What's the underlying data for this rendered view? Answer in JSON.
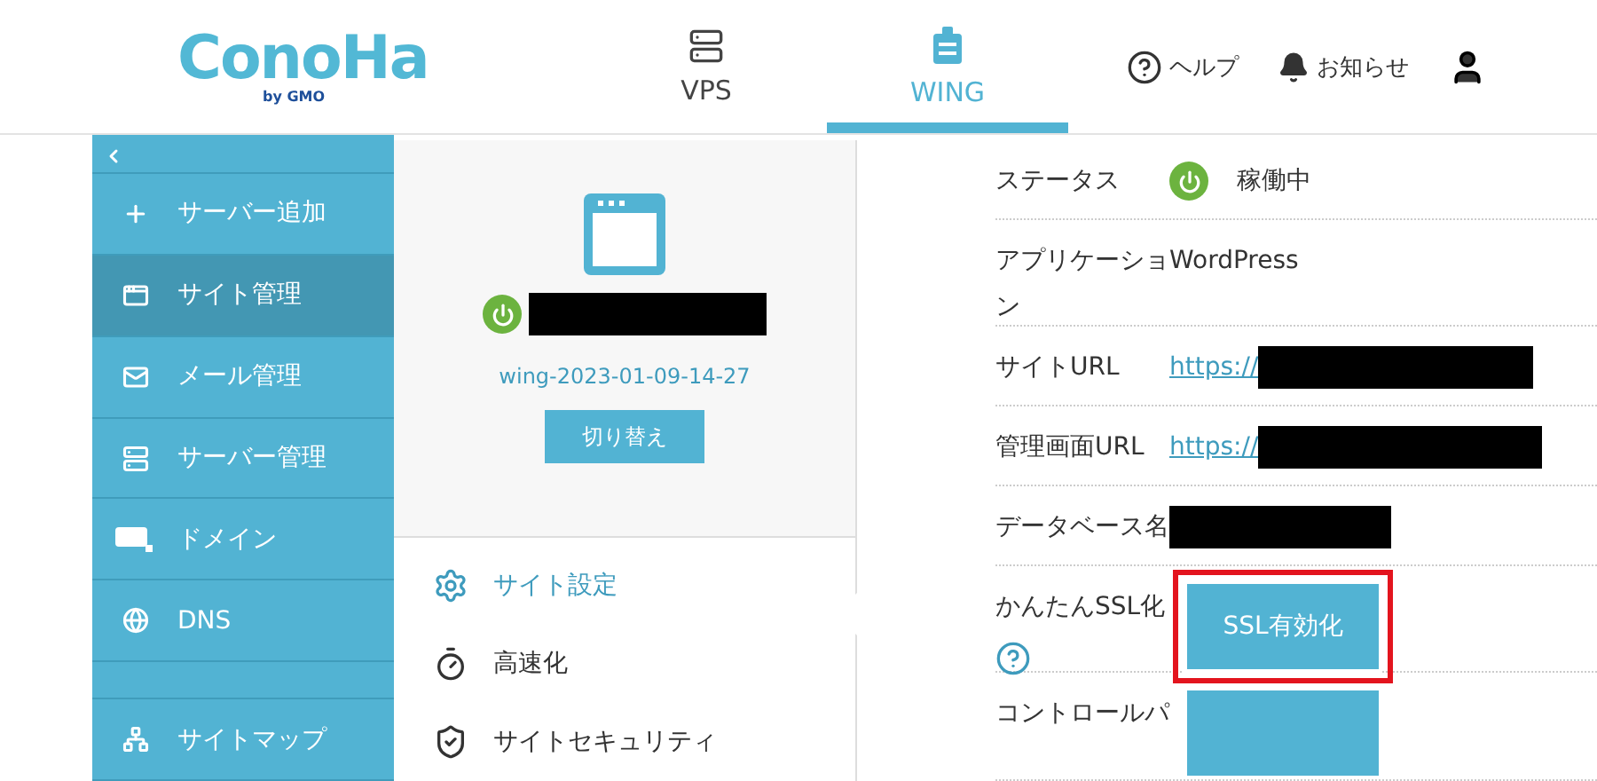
{
  "header": {
    "logo": {
      "name": "ConoHa",
      "sub": "by GMO"
    },
    "nav": [
      {
        "label": "VPS",
        "selected": false
      },
      {
        "label": "WING",
        "selected": true
      }
    ],
    "actions": [
      {
        "kind": "help",
        "label": "ヘルプ"
      },
      {
        "kind": "bell",
        "label": "お知らせ"
      },
      {
        "kind": "user"
      }
    ]
  },
  "sidebar": {
    "items": [
      {
        "label": "サーバー追加",
        "selected": false
      },
      {
        "label": "サイト管理",
        "selected": true
      },
      {
        "label": "メール管理",
        "selected": false
      },
      {
        "label": "サーバー管理",
        "selected": false
      },
      {
        "label": "ドメイン",
        "selected": false
      },
      {
        "label": "DNS",
        "selected": false
      },
      {
        "label": "サイトマップ",
        "selected": false
      }
    ]
  },
  "site": {
    "running": true,
    "name": "wing-2023-01-09-14-27",
    "switch_button": "切り替え",
    "menu": [
      {
        "label": "サイト設定",
        "selected": true
      },
      {
        "label": "高速化",
        "selected": false
      },
      {
        "label": "サイトセキュリティ",
        "selected": false
      }
    ]
  },
  "details": [
    {
      "kind": "status",
      "label": "ステータス",
      "running": true,
      "value": "稼働中"
    },
    {
      "kind": "text",
      "label": "アプリケーション",
      "value": "WordPress"
    },
    {
      "kind": "link",
      "label": "サイトURL",
      "value": "https://"
    },
    {
      "kind": "link",
      "label": "管理画面URL",
      "value": "https://"
    },
    {
      "kind": "redacted",
      "label": "データベース名"
    },
    {
      "kind": "button",
      "label": "かんたんSSL化",
      "button": "SSL有効化",
      "highlighted": true,
      "help": true
    },
    {
      "kind": "button",
      "label": "コントロールパ"
    }
  ]
}
